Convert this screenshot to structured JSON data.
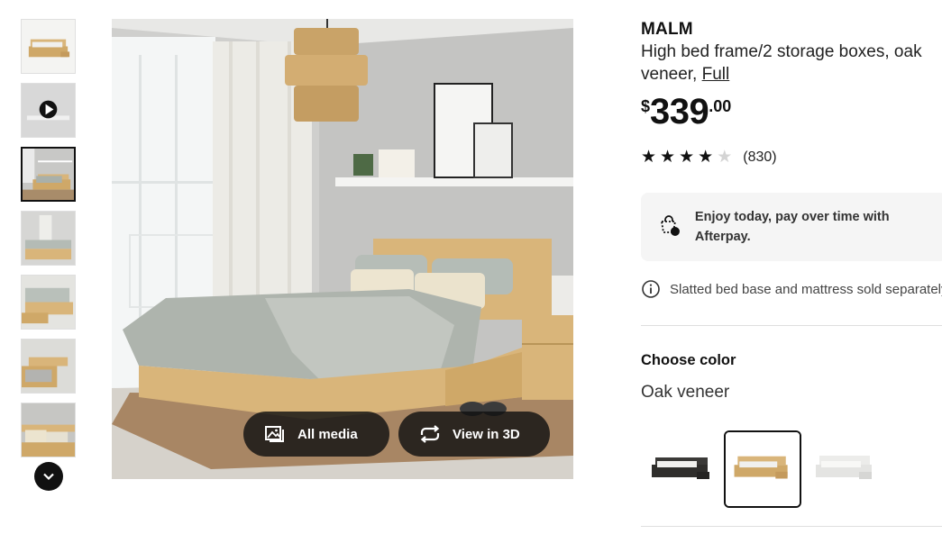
{
  "product": {
    "brand": "MALM",
    "description": "High bed frame/2 storage boxes, oak veneer,",
    "size_link": "Full",
    "price": {
      "currency": "$",
      "integer": "339",
      "decimal": ".00"
    },
    "rating": {
      "stars": 4,
      "max": 5,
      "count": "(830)"
    }
  },
  "afterpay": {
    "text": "Enjoy today, pay over time with Afterpay.",
    "icon": "afterpay-icon"
  },
  "note": {
    "text": "Slatted bed base and mattress sold separately.",
    "icon": "info-icon"
  },
  "color": {
    "label": "Choose color",
    "selected": "Oak veneer",
    "options": [
      {
        "name": "black-brown",
        "color": "#3b3a38"
      },
      {
        "name": "oak veneer",
        "color": "#d9b57a"
      },
      {
        "name": "white",
        "color": "#f4f4f2"
      }
    ]
  },
  "media": {
    "all_media_label": "All media",
    "view3d_label": "View in 3D",
    "all_media_icon": "gallery-icon",
    "view3d_icon": "rotate-3d-icon"
  },
  "thumbnails": {
    "count": 7,
    "selected_index": 2,
    "video_index": 1,
    "scroll_icon": "chevron-down-icon"
  },
  "colors": {
    "text": "#111111",
    "oak": "#d9b57a",
    "bg_panel": "#f5f5f5"
  }
}
